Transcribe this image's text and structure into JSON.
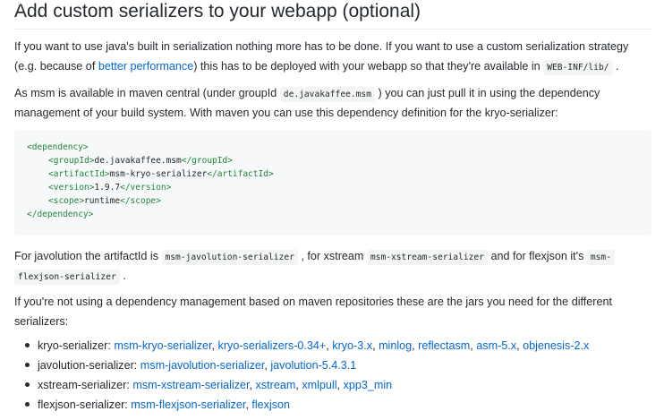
{
  "heading": "Add custom serializers to your webapp (optional)",
  "p1": {
    "l1": "If you want to use java's built in serialization nothing more has to be done. If you want to use a custom serialization strategy",
    "l2_a": "(e.g. because of ",
    "l2_link": "better performance",
    "l2_b": ") this has to be deployed with your webapp so that they're available in ",
    "l2_code": "WEB-INF/lib/",
    "l2_c": " ."
  },
  "p2": {
    "l1_a": "As msm is available in maven central (under groupId ",
    "l1_code": "de.javakaffee.msm",
    "l1_b": " ) you can just pull it in using the dependency",
    "l2": "management of your build system. With maven you can use this dependency definition for the kryo-serializer:"
  },
  "code": {
    "dep_open": "<dependency>",
    "group_open": "<groupId>",
    "group_val": "de.javakaffee.msm",
    "group_close": "</groupId>",
    "art_open": "<artifactId>",
    "art_val": "msm-kryo-serializer",
    "art_close": "</artifactId>",
    "ver_open": "<version>",
    "ver_val": "1.9.7",
    "ver_close": "</version>",
    "scope_open": "<scope>",
    "scope_val": "runtime",
    "scope_close": "</scope>",
    "dep_close": "</dependency>"
  },
  "p3": {
    "l1_a": "For javolution the artifactId is ",
    "l1_code1": "msm-javolution-serializer",
    "l1_b": " , for xstream ",
    "l1_code2": "msm-xstream-serializer",
    "l1_c": " and for flexjson it's ",
    "l1_code3a": "msm-",
    "l2_code3b": "flexjson-serializer",
    "l2_b": " ."
  },
  "p4": {
    "l1": "If you're not using a dependency management based on maven repositories these are the jars you need for the different",
    "l2": "serializers:"
  },
  "list": [
    {
      "label": "kryo-serializer: ",
      "links": [
        "msm-kryo-serializer",
        "kryo-serializers-0.34+",
        "kryo-3.x",
        "minlog",
        "reflectasm",
        "asm-5.x",
        "objenesis-2.x"
      ]
    },
    {
      "label": "javolution-serializer: ",
      "links": [
        "msm-javolution-serializer",
        "javolution-5.4.3.1"
      ]
    },
    {
      "label": "xstream-serializer: ",
      "links": [
        "msm-xstream-serializer",
        "xstream",
        "xmlpull",
        "xpp3_min"
      ]
    },
    {
      "label": "flexjson-serializer: ",
      "links": [
        "msm-flexjson-serializer",
        "flexjson"
      ]
    }
  ],
  "colors": {
    "link": "#0366d6",
    "text": "#24292e",
    "code_bg": "#f6f8fa",
    "tag": "#22863a"
  }
}
